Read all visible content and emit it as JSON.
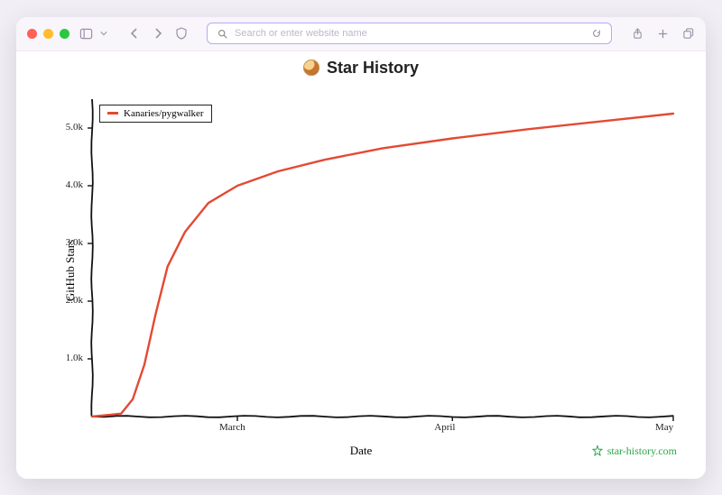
{
  "browser": {
    "url_placeholder": "Search or enter website name"
  },
  "chart_data": {
    "type": "line",
    "title": "Star History",
    "xlabel": "Date",
    "ylabel": "GitHub Stars",
    "x_categories": [
      "March",
      "April",
      "May"
    ],
    "y_ticks": [
      1000,
      2000,
      3000,
      4000,
      5000
    ],
    "y_tick_labels": [
      "1.0k",
      "2.0k",
      "3.0k",
      "4.0k",
      "5.0k"
    ],
    "ylim": [
      0,
      5500
    ],
    "series": [
      {
        "name": "Kanaries/pygwalker",
        "color": "#e34a33",
        "x": [
          0,
          5,
          7,
          9,
          11,
          13,
          16,
          20,
          25,
          32,
          40,
          50,
          62,
          75,
          88,
          100
        ],
        "values": [
          0,
          50,
          300,
          900,
          1800,
          2600,
          3200,
          3700,
          4000,
          4250,
          4450,
          4650,
          4820,
          4980,
          5120,
          5250
        ]
      }
    ],
    "watermark": "star-history.com"
  }
}
